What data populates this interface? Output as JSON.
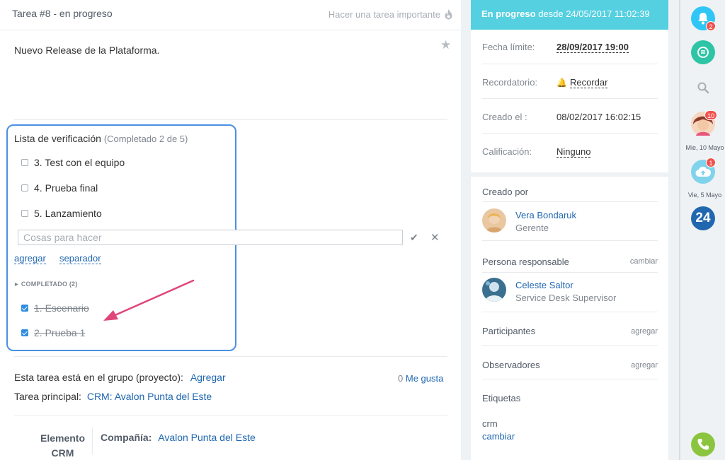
{
  "task": {
    "title": "Tarea #8 - en progreso",
    "important_label": "Hacer una tarea importante",
    "description": "Nuevo Release de la Plataforma."
  },
  "checklist": {
    "title": "Lista de verificación",
    "subtitle": "(Completado 2 de 5)",
    "open_items": [
      {
        "label": "3. Test con el equipo",
        "checked": false
      },
      {
        "label": "4. Prueba final",
        "checked": false
      },
      {
        "label": "5. Lanzamiento",
        "checked": false
      }
    ],
    "input_placeholder": "Cosas para hacer",
    "add_label": "agregar",
    "separator_label": "separador",
    "completed_heading": "COMPLETADO (2)",
    "completed_items": [
      {
        "label": "1. Escenario",
        "checked": true
      },
      {
        "label": "2. Prueba 1",
        "checked": true
      }
    ]
  },
  "group": {
    "label": "Esta tarea está en el grupo (proyecto):",
    "link": "Agregar",
    "likes_count": "0",
    "likes_label": "Me gusta"
  },
  "parent_task": {
    "label": "Tarea principal:",
    "link": "CRM: Avalon Punta del Este"
  },
  "crm": {
    "label": "Elemento CRM",
    "company_label": "Compañía:",
    "company_value": "Avalon Punta del Este"
  },
  "status": {
    "state": "En progreso",
    "since": "desde 24/05/2017 11:02:39",
    "deadline_label": "Fecha límite:",
    "deadline_value": "28/09/2017 19:00",
    "reminder_label": "Recordatorio:",
    "reminder_value": "Recordar",
    "created_label": "Creado el :",
    "created_value": "08/02/2017 16:02:15",
    "rating_label": "Calificación:",
    "rating_value": "Ninguno"
  },
  "people": {
    "created_by_heading": "Creado por",
    "creator_name": "Vera Bondaruk",
    "creator_position": "Gerente",
    "responsible_heading": "Persona responsable",
    "responsible_change": "cambiar",
    "responsible_name": "Celeste Saltor",
    "responsible_position": "Service Desk Supervisor",
    "participants_heading": "Participantes",
    "participants_add": "agregar",
    "observers_heading": "Observadores",
    "observers_add": "agregar",
    "tags_heading": "Etiquetas",
    "tag_value": "crm",
    "tag_change": "cambiar"
  },
  "sidebar": {
    "notifications_badge": "2",
    "chat1_badge": "10",
    "chat1_date": "Mie, 10 Mayo",
    "chat2_badge": "1",
    "chat2_date": "Vie, 5 Mayo",
    "logo_text": "24"
  },
  "colors": {
    "accent": "#55d0e0",
    "link": "#2067b0",
    "highlight_border": "#4a90e2",
    "arrow": "#e0457b",
    "badge": "#f0524e",
    "phone": "#8bc53f"
  }
}
